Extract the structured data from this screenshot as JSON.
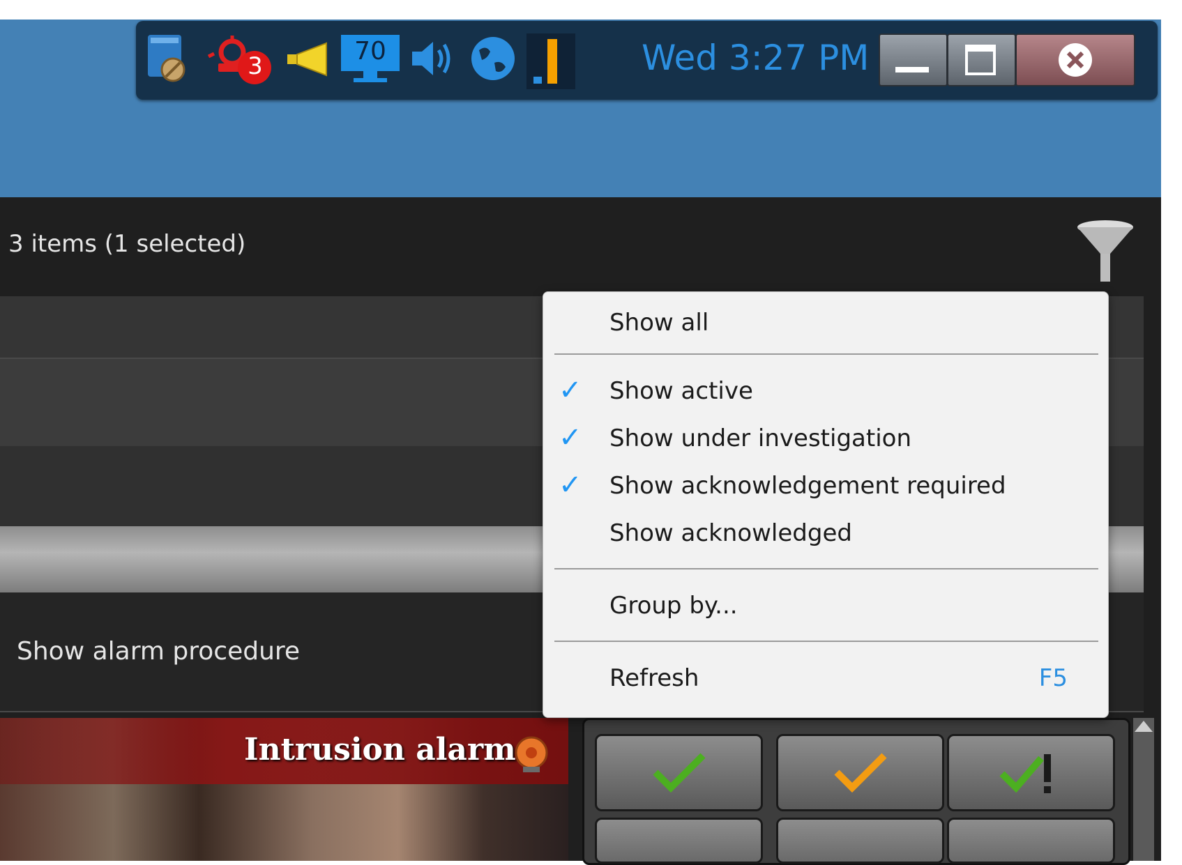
{
  "taskbar": {
    "clock": "Wed 3:27 PM",
    "alarm_badge": "3",
    "monitor_value": "70"
  },
  "panel": {
    "items_count": "3 items (1 selected)",
    "procedure_link": "Show alarm procedure"
  },
  "video": {
    "title": "Intrusion alarm"
  },
  "menu": {
    "show_all": "Show all",
    "show_active": "Show active",
    "show_under_investigation": "Show under investigation",
    "show_ack_required": "Show acknowledgement required",
    "show_acknowledged": "Show acknowledged",
    "group_by": "Group by...",
    "refresh": "Refresh",
    "refresh_shortcut": "F5",
    "checked": [
      "show_active",
      "show_under_investigation",
      "show_ack_required"
    ]
  },
  "colors": {
    "header_blue": "#4481b5",
    "accent_blue": "#2c8fe0",
    "check_green": "#4caf20",
    "check_orange": "#f39c12"
  }
}
